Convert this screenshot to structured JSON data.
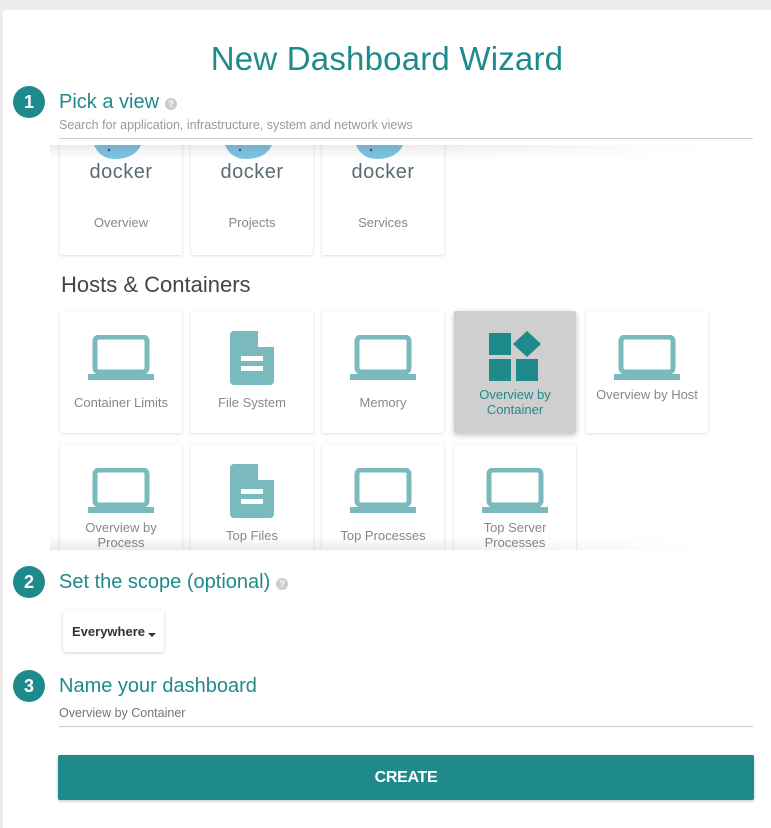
{
  "title": "New Dashboard Wizard",
  "colors": {
    "accent": "#1f8a8c",
    "icon_light": "#7ab9bc",
    "selected_bg": "#cfcfcf"
  },
  "steps": [
    {
      "number": "1",
      "title": "Pick a view",
      "help_icon": "help-icon"
    },
    {
      "number": "2",
      "title": "Set the scope (optional)",
      "help_icon": "help-icon"
    },
    {
      "number": "3",
      "title": "Name your dashboard"
    }
  ],
  "search": {
    "placeholder": "Search for application, infrastructure, system and network views",
    "value": ""
  },
  "docker_tiles": [
    {
      "label": "Overview",
      "icon": "docker-logo",
      "logo_text": "docker"
    },
    {
      "label": "Projects",
      "icon": "docker-logo",
      "logo_text": "docker"
    },
    {
      "label": "Services",
      "icon": "docker-logo",
      "logo_text": "docker"
    }
  ],
  "hosts_section": {
    "heading": "Hosts & Containers",
    "tiles": [
      {
        "label": "Container Limits",
        "icon": "laptop-icon",
        "selected": false
      },
      {
        "label": "File System",
        "icon": "document-icon",
        "selected": false
      },
      {
        "label": "Memory",
        "icon": "laptop-icon",
        "selected": false
      },
      {
        "label": "Overview by Container",
        "icon": "container-blocks-icon",
        "selected": true
      },
      {
        "label": "Overview by Host",
        "icon": "laptop-icon",
        "selected": false
      },
      {
        "label": "Overview by Process",
        "icon": "laptop-icon",
        "selected": false
      },
      {
        "label": "Top Files",
        "icon": "document-icon",
        "selected": false
      },
      {
        "label": "Top Processes",
        "icon": "laptop-icon",
        "selected": false
      },
      {
        "label": "Top Server Processes",
        "icon": "laptop-icon",
        "selected": false
      }
    ]
  },
  "scope": {
    "selected": "Everywhere"
  },
  "name_field": {
    "placeholder": "Overview by Container",
    "value": ""
  },
  "create_button": {
    "label": "CREATE"
  }
}
